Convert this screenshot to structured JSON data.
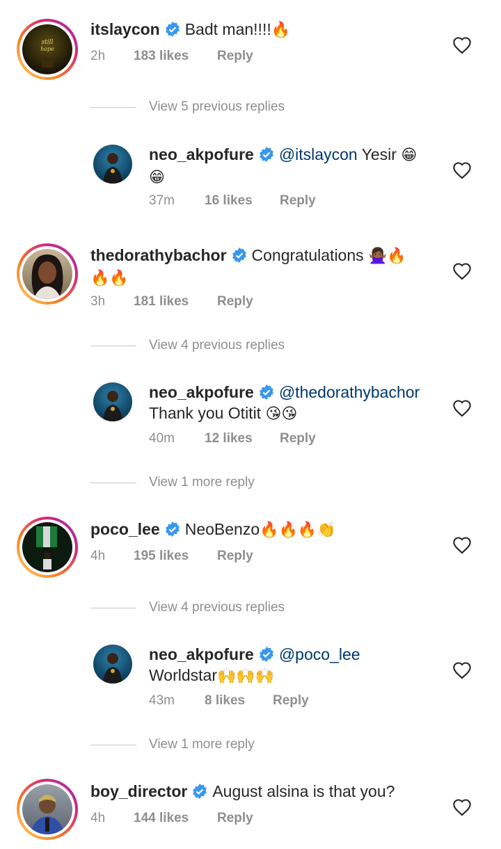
{
  "comments": [
    {
      "username": "itslaycon",
      "text": "Badt man!!!!",
      "emoji": "🔥",
      "time": "2h",
      "likes": "183 likes",
      "reply": "Reply"
    },
    {
      "view_replies": "View 5 previous replies"
    },
    {
      "username": "neo_akpofure",
      "mention": "@itslaycon",
      "text": " Yesir",
      "emoji": "😁",
      "emoji2": "😁",
      "time": "37m",
      "likes": "16 likes",
      "reply": "Reply"
    },
    {
      "username": "thedorathybachor",
      "text": "Congratulations",
      "emoji": "🙅🏾‍♀️🔥",
      "emoji2": "🔥🔥",
      "time": "3h",
      "likes": "181 likes",
      "reply": "Reply"
    },
    {
      "view_replies": "View 4 previous replies"
    },
    {
      "username": "neo_akpofure",
      "mention": "@thedorathybachor",
      "text": "Thank you Otitit",
      "emoji": "😘😘",
      "time": "40m",
      "likes": "12 likes",
      "reply": "Reply"
    },
    {
      "view_replies": "View 1 more reply"
    },
    {
      "username": "poco_lee",
      "text": "NeoBenzo",
      "emoji": "🔥🔥🔥👏",
      "time": "4h",
      "likes": "195 likes",
      "reply": "Reply"
    },
    {
      "view_replies": "View 4 previous replies"
    },
    {
      "username": "neo_akpofure",
      "mention": "@poco_lee",
      "text": "Worldstar",
      "emoji": "🙌🙌🙌",
      "time": "43m",
      "likes": "8 likes",
      "reply": "Reply"
    },
    {
      "view_replies": "View 1 more reply"
    },
    {
      "username": "boy_director",
      "text": "August alsina is that you?",
      "time": "4h",
      "likes": "144 likes",
      "reply": "Reply"
    }
  ],
  "colors": {
    "verified": "#3897f0",
    "mention": "#00376b",
    "secondary": "#8e8e8e"
  }
}
